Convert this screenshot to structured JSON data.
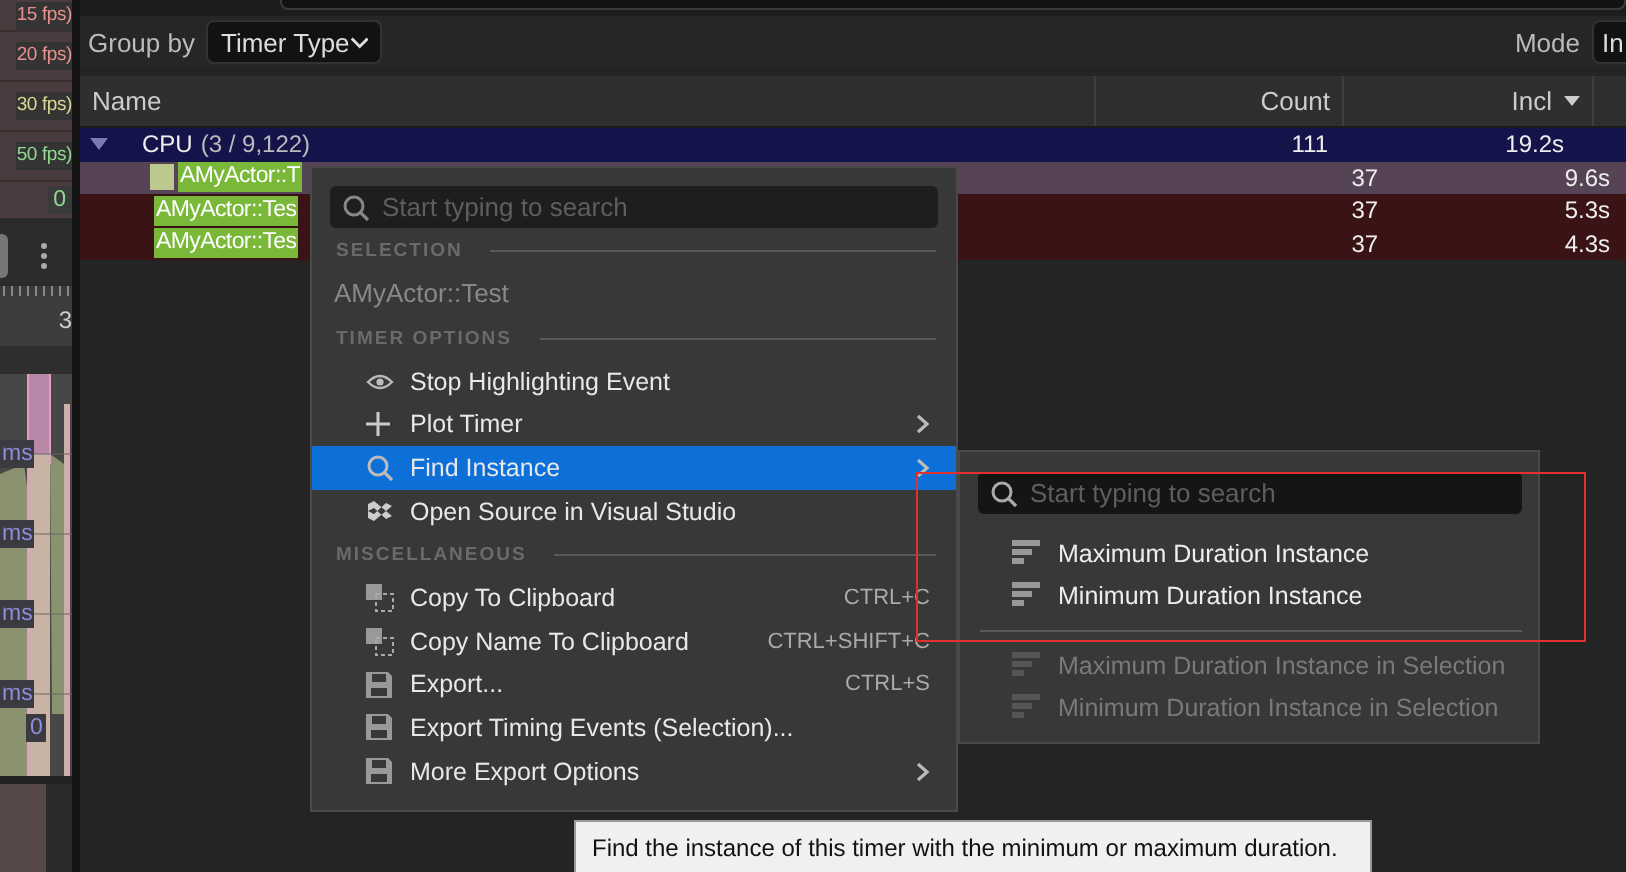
{
  "side_strip": {
    "fps_labels": [
      {
        "text": "15 fps)",
        "color": "#e89090"
      },
      {
        "text": "20 fps)",
        "color": "#e89090"
      },
      {
        "text": "30 fps)",
        "color": "#d8d890"
      },
      {
        "text": "50 fps)",
        "color": "#90d890"
      }
    ],
    "zero": "0",
    "ruler_label": "3",
    "axis_labels": [
      "ms",
      "ms",
      "ms",
      "ms"
    ],
    "axis_zero": "0"
  },
  "toolbar": {
    "group_by_label": "Group by",
    "group_by_value": "Timer Type",
    "mode_label": "Mode",
    "mode_value": "In"
  },
  "table": {
    "columns": [
      {
        "label": "Name",
        "sorted": false
      },
      {
        "label": "Count",
        "sorted": false
      },
      {
        "label": "Incl",
        "sorted": true
      }
    ],
    "rows": [
      {
        "kind": "group",
        "name": "CPU",
        "detail": "(3 / 9,122)",
        "expanded": true,
        "count": "111",
        "incl": "19.2s",
        "color": "#14144a"
      },
      {
        "kind": "timer",
        "name": "AMyActor::T",
        "swatch": true,
        "count": "37",
        "incl": "9.6s",
        "color": "#574356"
      },
      {
        "kind": "timer",
        "name": "AMyActor::Tes",
        "swatch": false,
        "count": "37",
        "incl": "5.3s",
        "color": "#3a1315"
      },
      {
        "kind": "timer",
        "name": "AMyActor::Tes",
        "swatch": false,
        "count": "37",
        "incl": "4.3s",
        "color": "#3a1315"
      }
    ]
  },
  "context_menu": {
    "search_placeholder": "Start typing to search",
    "sections": [
      {
        "heading": "SELECTION",
        "items": [
          {
            "kind": "caption",
            "label": "AMyActor::Test"
          }
        ]
      },
      {
        "heading": "TIMER OPTIONS",
        "items": [
          {
            "kind": "command",
            "label": "Stop Highlighting Event",
            "submenu": false,
            "selected": false
          },
          {
            "kind": "command",
            "label": "Plot Timer",
            "submenu": true,
            "selected": false
          },
          {
            "kind": "command",
            "label": "Find Instance",
            "submenu": true,
            "selected": true
          },
          {
            "kind": "command",
            "label": "Open Source in Visual Studio",
            "submenu": false,
            "selected": false
          }
        ]
      },
      {
        "heading": "MISCELLANEOUS",
        "items": [
          {
            "kind": "command",
            "label": "Copy To Clipboard",
            "shortcut": "CTRL+C",
            "submenu": false,
            "selected": false
          },
          {
            "kind": "command",
            "label": "Copy Name To Clipboard",
            "shortcut": "CTRL+SHIFT+C",
            "submenu": false,
            "selected": false
          },
          {
            "kind": "command",
            "label": "Export...",
            "shortcut": "CTRL+S",
            "submenu": false,
            "selected": false
          },
          {
            "kind": "command",
            "label": "Export Timing Events (Selection)...",
            "submenu": false,
            "selected": false
          },
          {
            "kind": "command",
            "label": "More Export Options",
            "submenu": true,
            "selected": false
          }
        ]
      }
    ]
  },
  "submenu": {
    "search_placeholder": "Start typing to search",
    "groups": [
      [
        {
          "label": "Maximum Duration Instance",
          "disabled": false
        },
        {
          "label": "Minimum Duration Instance",
          "disabled": false
        }
      ],
      [
        {
          "label": "Maximum Duration Instance in Selection",
          "disabled": true
        },
        {
          "label": "Minimum Duration Instance in Selection",
          "disabled": true
        }
      ]
    ]
  },
  "tooltip": {
    "text": "Find the instance of this timer with the minimum or maximum duration."
  },
  "annotation": {
    "kind": "rectangle",
    "color": "#e03030"
  }
}
